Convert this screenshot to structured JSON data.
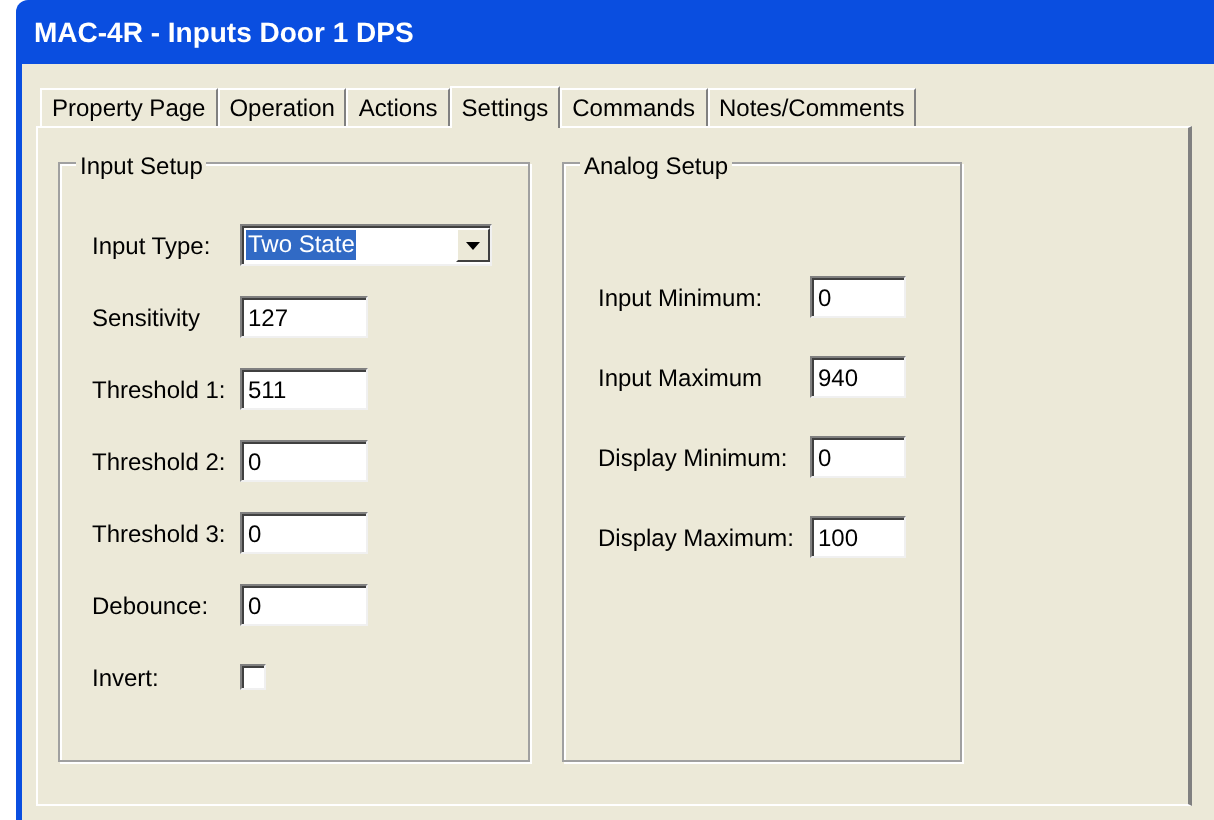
{
  "window": {
    "title": "MAC-4R - Inputs Door 1 DPS"
  },
  "tabs": [
    {
      "label": "Property Page",
      "selected": false
    },
    {
      "label": "Operation",
      "selected": false
    },
    {
      "label": "Actions",
      "selected": false
    },
    {
      "label": "Settings",
      "selected": true
    },
    {
      "label": "Commands",
      "selected": false
    },
    {
      "label": "Notes/Comments",
      "selected": false
    }
  ],
  "input_setup": {
    "title": "Input Setup",
    "fields": [
      {
        "kind": "dropdown",
        "label": "Input Type:",
        "value": "Two State"
      },
      {
        "kind": "text",
        "label": "Sensitivity",
        "value": "127"
      },
      {
        "kind": "text",
        "label": "Threshold 1:",
        "value": "511"
      },
      {
        "kind": "text",
        "label": "Threshold 2:",
        "value": "0"
      },
      {
        "kind": "text",
        "label": "Threshold 3:",
        "value": "0"
      },
      {
        "kind": "text",
        "label": "Debounce:",
        "value": "0"
      },
      {
        "kind": "checkbox",
        "label": "Invert:",
        "checked": false
      }
    ]
  },
  "analog_setup": {
    "title": "Analog Setup",
    "fields": [
      {
        "label": "Input Minimum:",
        "value": "0"
      },
      {
        "label": "Input Maximum",
        "value": "940"
      },
      {
        "label": "Display Minimum:",
        "value": "0"
      },
      {
        "label": "Display Maximum:",
        "value": "100"
      }
    ]
  }
}
